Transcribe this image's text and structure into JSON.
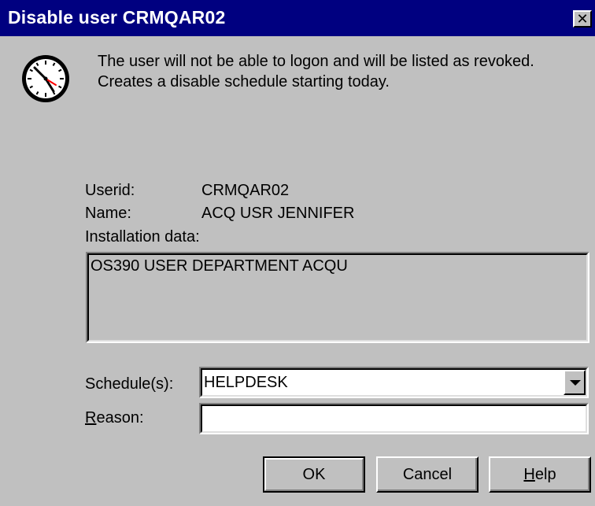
{
  "window": {
    "title": "Disable user CRMQAR02",
    "close_symbol": "✕"
  },
  "icons": {
    "clock": "clock-icon",
    "close": "close-icon",
    "dropdown": "chevron-down-icon"
  },
  "message": {
    "line1": "The user will not be able to logon and will be listed as revoked.",
    "line2": "Creates a disable schedule starting today."
  },
  "user": {
    "userid_label": "Userid:",
    "userid_value": "CRMQAR02",
    "name_label": "Name:",
    "name_value": "ACQ USR JENNIFER",
    "installation_label": "Installation data:",
    "installation_value": "OS390 USER DEPARTMENT ACQU"
  },
  "schedule": {
    "label": "Schedule(s):",
    "selected": "HELPDESK"
  },
  "reason": {
    "label_accel": "R",
    "label_rest": "eason:",
    "value": ""
  },
  "buttons": {
    "ok": "OK",
    "cancel": "Cancel",
    "help_accel": "H",
    "help_rest": "elp"
  },
  "colors": {
    "titlebar": "#000080",
    "face": "#c0c0c0",
    "clock_hand_accent": "#ff0000"
  }
}
